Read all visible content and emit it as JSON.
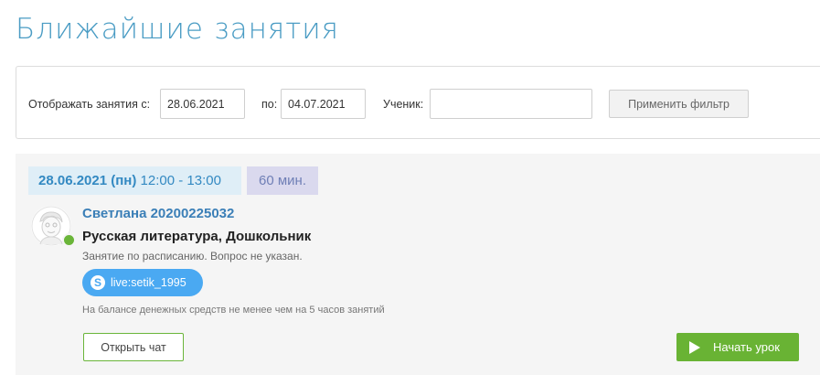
{
  "page": {
    "title": "Ближайшие занятия"
  },
  "filter": {
    "from_label": "Отображать занятия с:",
    "from_value": "28.06.2021",
    "to_label": "по:",
    "to_value": "04.07.2021",
    "student_label": "Ученик:",
    "student_value": "",
    "apply_label": "Применить фильтр"
  },
  "lesson": {
    "date": "28.06.2021 (пн)",
    "time": "12:00 - 13:00",
    "duration": "60 мин.",
    "student_name": "Светлана 20200225032",
    "subject": "Русская литература, Дошкольник",
    "note": "Занятие по расписанию. Вопрос не указан.",
    "skype_id": "live:setik_1995",
    "balance_note": "На балансе денежных средств не менее чем на 5 часов занятий",
    "open_chat_label": "Открыть чат",
    "start_label": "Начать урок",
    "online": true,
    "avatar_icon": "cartoon-face-avatar",
    "skype_icon": "skype-icon"
  },
  "colors": {
    "title": "#4a9cc4",
    "accent_green": "#69b334",
    "link_blue": "#3b7fb7",
    "skype_blue": "#4aa9f2",
    "date_bg": "#dfeef7",
    "duration_bg": "#dad9ee"
  }
}
